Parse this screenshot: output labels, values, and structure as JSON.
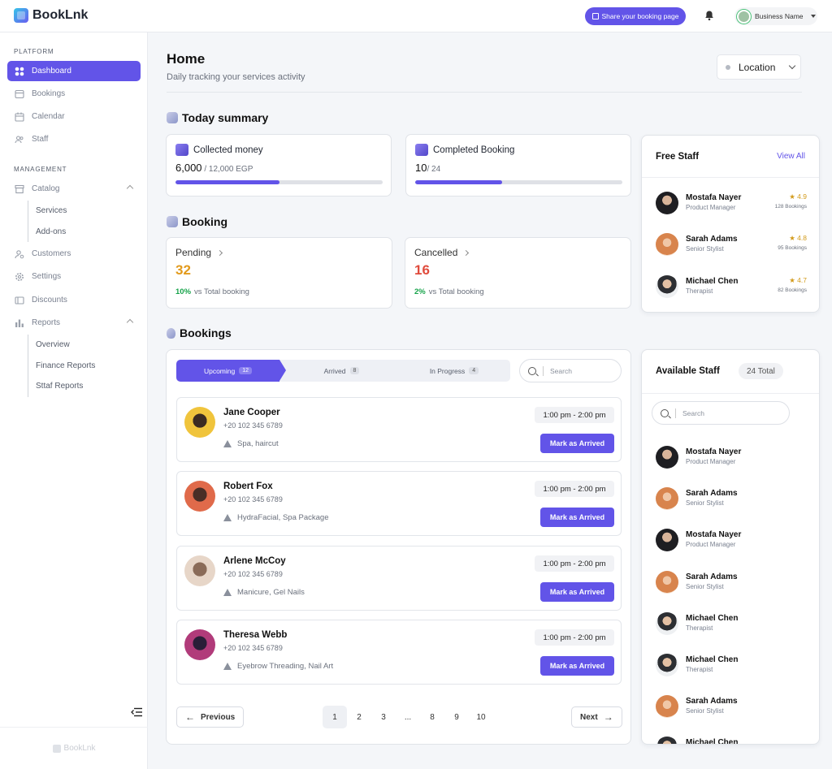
{
  "app": {
    "name": "BookLnk"
  },
  "topbar": {
    "share_label": "Share your booking page",
    "business_name": "Business Name"
  },
  "sidebar": {
    "platform_label": "PLATFORM",
    "management_label": "MANAGEMENT",
    "items": [
      {
        "label": "Dashboard"
      },
      {
        "label": "Bookings"
      },
      {
        "label": "Calendar"
      },
      {
        "label": "Staff"
      },
      {
        "label": "Catalog"
      },
      {
        "label": "Customers"
      },
      {
        "label": "Settings"
      },
      {
        "label": "Discounts"
      },
      {
        "label": "Reports"
      }
    ],
    "catalog_sub": [
      "Services",
      "Add-ons"
    ],
    "reports_sub": [
      "Overview",
      "Finance Reports",
      "Sttaf Reports"
    ],
    "footer_brand": "BookLnk"
  },
  "page": {
    "title": "Home",
    "subtitle": "Daily tracking your services activity",
    "location_label": "Location"
  },
  "summary": {
    "title": "Today summary",
    "collected": {
      "label": "Collected money",
      "value": "6,000",
      "total": " / 12,000 EGP",
      "progress": 0.5
    },
    "completed": {
      "label": "Completed Booking",
      "value": "10",
      "total": "/ 24",
      "progress": 0.42
    }
  },
  "booking": {
    "title": "Booking",
    "pending": {
      "label": "Pending",
      "value": "32",
      "pct": "10%",
      "suffix": "vs Total booking",
      "color": "#e29a1c"
    },
    "cancelled": {
      "label": "Cancelled",
      "value": "16",
      "pct": "2%",
      "suffix": "vs Total booking",
      "color": "#e04b3c"
    }
  },
  "free_staff": {
    "title": "Free Staff",
    "view_all": "View All",
    "list": [
      {
        "name": "Mostafa Nayer",
        "role": "Product Manager",
        "rating": "★ 4.9",
        "bookings": "128 Bookings"
      },
      {
        "name": "Sarah Adams",
        "role": "Senior Stylist",
        "rating": "★ 4.8",
        "bookings": "95 Bookings"
      },
      {
        "name": "Michael Chen",
        "role": "Therapist",
        "rating": "★ 4.7",
        "bookings": "82 Bookings"
      }
    ]
  },
  "bookings": {
    "title": "Bookings",
    "tabs": [
      {
        "label": "Upcoming",
        "count": "12"
      },
      {
        "label": "Arrived",
        "count": "8"
      },
      {
        "label": "In Progress",
        "count": "4"
      }
    ],
    "search_placeholder": "Search",
    "mark_label": "Mark as Arrived",
    "rows": [
      {
        "name": "Jane Cooper",
        "phone": "+20 102 345 6789",
        "services": "Spa, haircut",
        "time": "1:00 pm - 2:00 pm"
      },
      {
        "name": "Robert Fox",
        "phone": "+20 102 345 6789",
        "services": "HydraFacial, Spa Package",
        "time": "1:00 pm - 2:00 pm"
      },
      {
        "name": "Arlene McCoy",
        "phone": "+20 102 345 6789",
        "services": "Manicure, Gel Nails",
        "time": "1:00 pm - 2:00 pm"
      },
      {
        "name": "Theresa Webb",
        "phone": "+20 102 345 6789",
        "services": "Eyebrow Threading, Nail Art",
        "time": "1:00 pm - 2:00 pm"
      }
    ],
    "pagination": {
      "prev": "Previous",
      "next": "Next",
      "pages": [
        "1",
        "2",
        "3",
        "...",
        "8",
        "9",
        "10"
      ],
      "current": "1"
    }
  },
  "available_staff": {
    "title": "Available Staff",
    "total": "24 Total",
    "search_placeholder": "Search",
    "list": [
      {
        "name": "Mostafa Nayer",
        "role": "Product Manager"
      },
      {
        "name": "Sarah Adams",
        "role": "Senior Stylist"
      },
      {
        "name": "Mostafa Nayer",
        "role": "Product Manager"
      },
      {
        "name": "Sarah Adams",
        "role": "Senior Stylist"
      },
      {
        "name": "Michael Chen",
        "role": "Therapist"
      },
      {
        "name": "Michael Chen",
        "role": "Therapist"
      },
      {
        "name": "Sarah Adams",
        "role": "Senior Stylist"
      },
      {
        "name": "Michael Chen",
        "role": ""
      }
    ]
  },
  "colors": {
    "accent": "#6254e8",
    "positive": "#16a34a",
    "star": "#d29a1a"
  }
}
